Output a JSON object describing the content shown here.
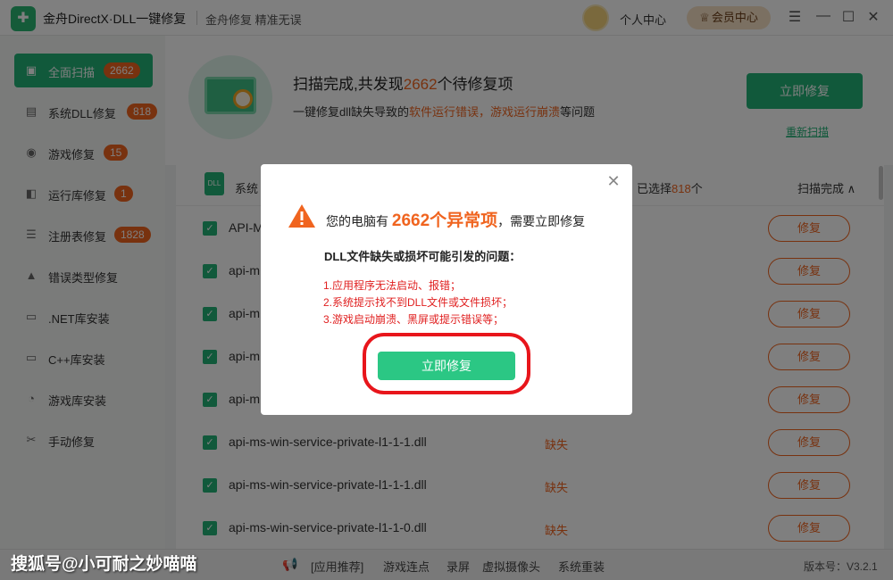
{
  "titlebar": {
    "app_title": "金舟DirectX·DLL一键修复",
    "slogan": "金舟修复 精准无误",
    "personal_center": "个人中心",
    "member_center": "会员中心",
    "logo_icon": "wrench-icon"
  },
  "sidebar": {
    "items": [
      {
        "label": "全面扫描",
        "badge": "2662",
        "icon": "scan-icon",
        "active": true
      },
      {
        "label": "系统DLL修复",
        "badge": "818",
        "icon": "dll-icon"
      },
      {
        "label": "游戏修复",
        "badge": "15",
        "icon": "gamepad-icon"
      },
      {
        "label": "运行库修复",
        "badge": "1",
        "icon": "runtime-icon"
      },
      {
        "label": "注册表修复",
        "badge": "1828",
        "icon": "registry-icon"
      },
      {
        "label": "错误类型修复",
        "icon": "warning-icon"
      },
      {
        "label": ".NET库安装",
        "icon": "dotnet-icon"
      },
      {
        "label": "C++库安装",
        "icon": "cpp-icon"
      },
      {
        "label": "游戏库安装",
        "icon": "pacman-icon"
      },
      {
        "label": "手动修复",
        "icon": "tools-icon"
      }
    ]
  },
  "header": {
    "headline_pre": "扫描完成,共发现",
    "headline_num": "2662",
    "headline_post": "个待修复项",
    "sub_pre": "一键修复dll缺失导致的",
    "sub_err": "软件运行错误，游戏运行崩溃",
    "sub_post": "等问题",
    "repair_button": "立即修复",
    "rescan_link": "重新扫描"
  },
  "list": {
    "category_badge": "DLL",
    "category_name": "系统",
    "selected_pre": "已选择",
    "selected_num": "818",
    "selected_post": "个",
    "scan_status": "扫描完成",
    "rows": [
      {
        "name": "API-M",
        "status": "",
        "button": "修复"
      },
      {
        "name": "api-m",
        "status": "",
        "button": "修复"
      },
      {
        "name": "api-m",
        "status": "",
        "button": "修复"
      },
      {
        "name": "api-m",
        "status": "",
        "button": "修复"
      },
      {
        "name": "api-m",
        "status": "",
        "button": "修复"
      },
      {
        "name": "api-ms-win-service-private-l1-1-1.dll",
        "status": "缺失",
        "button": "修复"
      },
      {
        "name": "api-ms-win-service-private-l1-1-1.dll",
        "status": "缺失",
        "button": "修复"
      },
      {
        "name": "api-ms-win-service-private-l1-1-0.dll",
        "status": "缺失",
        "button": "修复"
      }
    ]
  },
  "footer": {
    "links": [
      "[应用推荐]",
      "游戏连点",
      "录屏",
      "虚拟摄像头",
      "系统重装"
    ],
    "version": "版本号：V3.2.1"
  },
  "modal": {
    "title_pre": "您的电脑有",
    "title_big": "2662个异常项",
    "title_post": "，需要立即修复",
    "subtitle": "DLL文件缺失或损坏可能引发的问题：",
    "issues": [
      "1.应用程序无法启动、报错；",
      "2.系统提示找不到DLL文件或文件损坏；",
      "3.游戏启动崩溃、黑屏或提示错误等；"
    ],
    "button": "立即修复"
  },
  "watermark": "搜狐号@小可耐之妙喵喵",
  "colors": {
    "accent": "#23b277",
    "warning": "#f0641f",
    "danger": "#e02020",
    "highlight": "#e8151b"
  }
}
